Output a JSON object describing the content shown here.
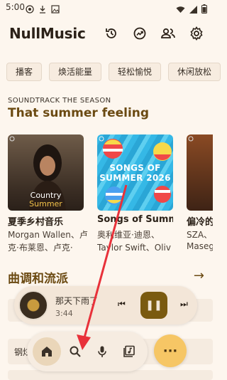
{
  "status": {
    "time": "5:00"
  },
  "app": {
    "title": "NullMusic"
  },
  "header_icons": [
    "history-icon",
    "stats-icon",
    "people-icon",
    "settings-icon"
  ],
  "chips": [
    "播客",
    "焕活能量",
    "轻松愉悦",
    "休闲放松"
  ],
  "section1": {
    "eyebrow": "SOUNDTRACK THE SEASON",
    "title": "That summer feeling"
  },
  "cards": [
    {
      "art_line1": "Country",
      "art_line2": "Summer",
      "title": "夏季乡村音乐",
      "sub1": "Morgan Wallen、卢",
      "sub2": "克·布莱恩、卢克·"
    },
    {
      "art_line1": "SONGS OF",
      "art_line2": "SUMMER 2026",
      "title": "Songs of Summe",
      "sub1": "奥利维亚·迪恩、",
      "sub2": "Taylor Swift、Oliv"
    },
    {
      "title": "偏冷的",
      "sub1": "SZA、",
      "sub2": "Masego"
    }
  ],
  "section2": {
    "title": "曲调和流派",
    "arrow": "→"
  },
  "player": {
    "title": "那天下雨了",
    "time": "3:44",
    "prev": "⏮",
    "pause": "❚❚",
    "next": "⏭"
  },
  "list_row": {
    "label": "钢炫"
  },
  "fab": {
    "label": "···"
  },
  "colors": {
    "accent": "#7a5a10",
    "title": "#6b4a12",
    "fab": "#f6c665",
    "annotation": "#e8313a"
  }
}
